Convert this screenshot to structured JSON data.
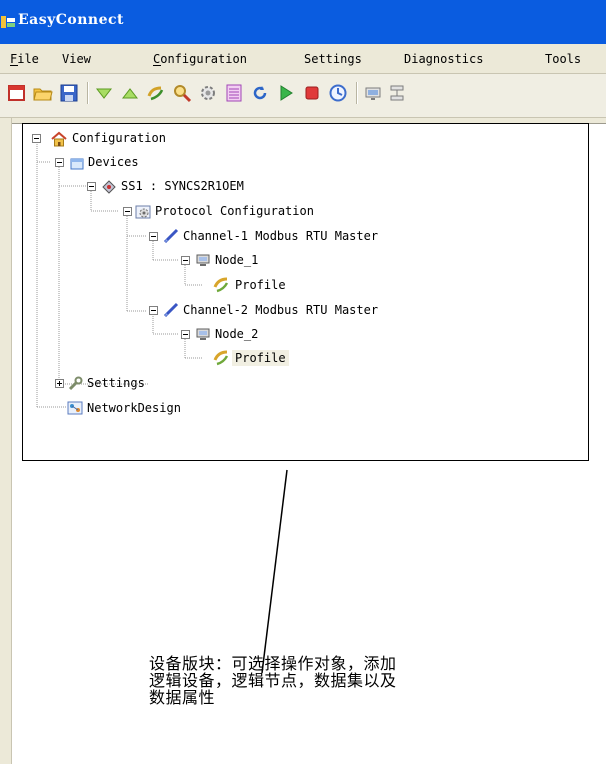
{
  "window": {
    "title": "EasyConnect",
    "titlebar_color": "#0a5ce0"
  },
  "menu": [
    {
      "label": "File"
    },
    {
      "label": "View"
    },
    {
      "label": "Configuration"
    },
    {
      "label": "Settings"
    },
    {
      "label": "Diagnostics"
    },
    {
      "label": "Tools"
    }
  ],
  "toolbar": {
    "icons": [
      "new-icon",
      "open-folder-icon",
      "save-icon",
      "download-icon",
      "upload-icon",
      "connect-icon",
      "search-icon",
      "settings-gear-icon",
      "list-icon",
      "refresh-icon",
      "run-icon",
      "stop-icon",
      "clock-icon",
      "monitor-icon",
      "network-icon"
    ]
  },
  "tree": {
    "root": "Configuration",
    "devices": "Devices",
    "device": "SS1 : SYNCS2R1OEM",
    "protocol": "Protocol Configuration",
    "channel1": "Channel-1 Modbus RTU Master",
    "node1": "Node_1",
    "profile1": "Profile",
    "channel2": "Channel-2 Modbus RTU Master",
    "node2": "Node_2",
    "profile2": "Profile",
    "settings": "Settings",
    "network": "NetworkDesign"
  },
  "callout": {
    "text": "设备版块：可选择操作对象，添加逻辑设备，逻辑节点，数据集以及数据属性"
  }
}
